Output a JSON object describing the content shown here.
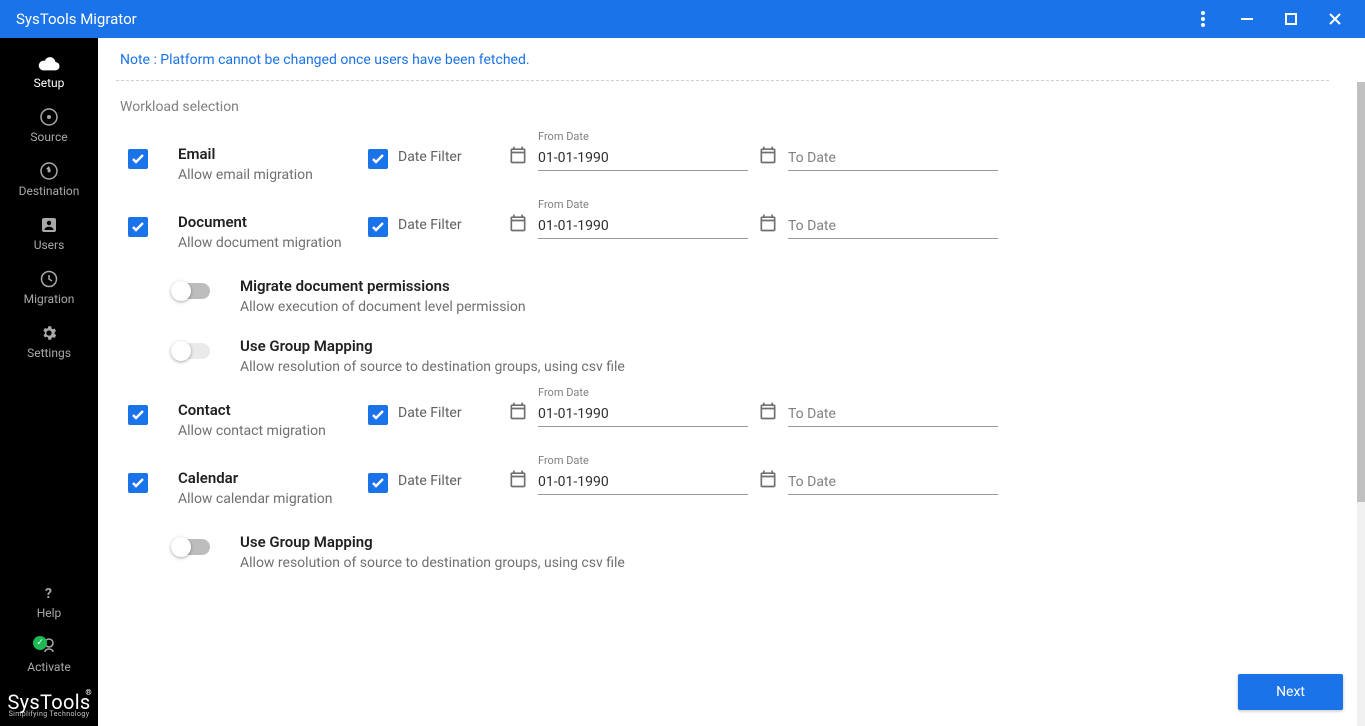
{
  "title": "SysTools Migrator",
  "note": "Note : Platform cannot be changed once users have been fetched.",
  "section_label": "Workload selection",
  "sidebar": {
    "items": [
      {
        "label": "Setup"
      },
      {
        "label": "Source"
      },
      {
        "label": "Destination"
      },
      {
        "label": "Users"
      },
      {
        "label": "Migration"
      },
      {
        "label": "Settings"
      }
    ],
    "help": "Help",
    "activate": "Activate",
    "brand": "SysTools",
    "brand_sub": "Simplifying Technology"
  },
  "workloads": {
    "email": {
      "title": "Email",
      "sub": "Allow email migration",
      "filter_label": "Date Filter",
      "from_caption": "From Date",
      "from_value": "01-01-1990",
      "to_placeholder": "To Date"
    },
    "document": {
      "title": "Document",
      "sub": "Allow document migration",
      "filter_label": "Date Filter",
      "from_caption": "From Date",
      "from_value": "01-01-1990",
      "to_placeholder": "To Date",
      "opt1_title": "Migrate document permissions",
      "opt1_sub": "Allow execution of document level permission",
      "opt2_title": "Use Group Mapping",
      "opt2_sub": "Allow resolution of source to destination groups, using csv file"
    },
    "contact": {
      "title": "Contact",
      "sub": "Allow contact migration",
      "filter_label": "Date Filter",
      "from_caption": "From Date",
      "from_value": "01-01-1990",
      "to_placeholder": "To Date"
    },
    "calendar": {
      "title": "Calendar",
      "sub": "Allow calendar migration",
      "filter_label": "Date Filter",
      "from_caption": "From Date",
      "from_value": "01-01-1990",
      "to_placeholder": "To Date",
      "opt1_title": "Use Group Mapping",
      "opt1_sub": "Allow resolution of source to destination groups, using csv file"
    }
  },
  "next_label": "Next"
}
